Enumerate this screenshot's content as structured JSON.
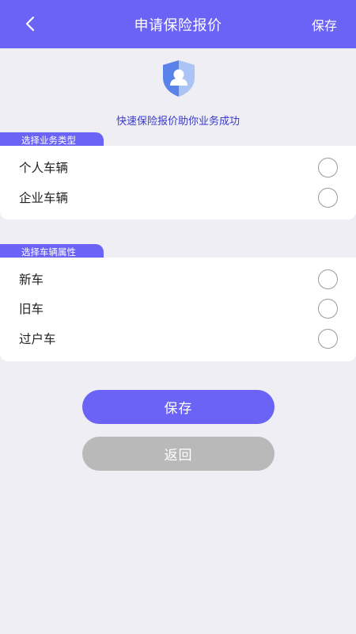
{
  "header": {
    "title": "申请保险报价",
    "save_label": "保存"
  },
  "tagline": "快速保险报价助你业务成功",
  "business_type": {
    "label": "选择业务类型",
    "options": [
      {
        "label": "个人车辆",
        "selected": false
      },
      {
        "label": "企业车辆",
        "selected": false
      }
    ]
  },
  "vehicle_attr": {
    "label": "选择车辆属性",
    "options": [
      {
        "label": "新车",
        "selected": false
      },
      {
        "label": "旧车",
        "selected": false
      },
      {
        "label": "过户车",
        "selected": false
      }
    ]
  },
  "buttons": {
    "save_label": "保存",
    "back_label": "返回"
  },
  "colors": {
    "accent": "#6b63f6",
    "background": "#eeeef4",
    "disabled_button": "#b9b9b9",
    "tagline": "#3a3acb"
  }
}
